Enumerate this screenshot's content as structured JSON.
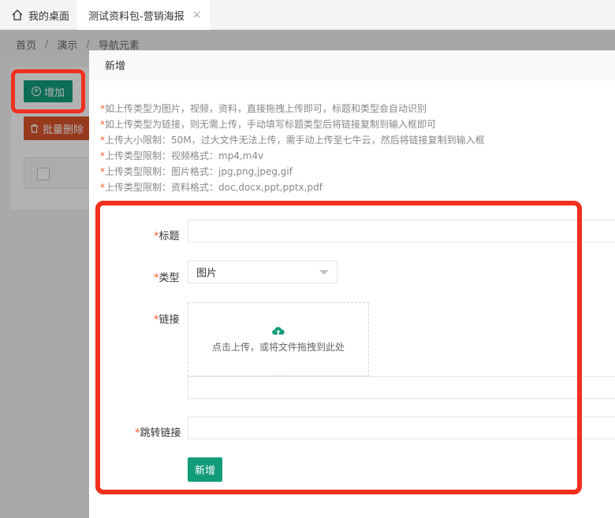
{
  "tabs": {
    "home_label": "我的桌面",
    "active_label": "测试资料包-营销海报",
    "close_glyph": "×"
  },
  "breadcrumb": [
    "首页",
    "演示",
    "导航元素"
  ],
  "background": {
    "add_button": "增加",
    "batch_delete_button": "批量删除"
  },
  "modal": {
    "title": "新增",
    "tips": [
      "如上传类型为图片，视频，资料，直接拖拽上传即可，标题和类型会自动识别",
      "如上传类型为链接，则无需上传，手动填写标题类型后将链接复制到输入框即可",
      "上传大小限制：50M，过大文件无法上传，需手动上传至七牛云，然后将链接复制到输入框",
      "上传类型限制：视频格式：mp4,m4v",
      "上传类型限制：图片格式：jpg,png,jpeg,gif",
      "上传类型限制：资料格式：doc,docx,ppt,pptx,pdf"
    ],
    "form": {
      "required_mark": "*",
      "title_label": "标题",
      "title_value": "",
      "type_label": "类型",
      "type_value": "图片",
      "link_label": "链接",
      "upload_hint": "点击上传，或将文件拖拽到此处",
      "link_value": "",
      "jump_label": "跳转链接",
      "jump_value": "",
      "submit_label": "新增"
    }
  },
  "colors": {
    "primary": "#139c7a",
    "danger": "#d9542b",
    "annotation": "#f0301d",
    "required": "#ff5722"
  }
}
